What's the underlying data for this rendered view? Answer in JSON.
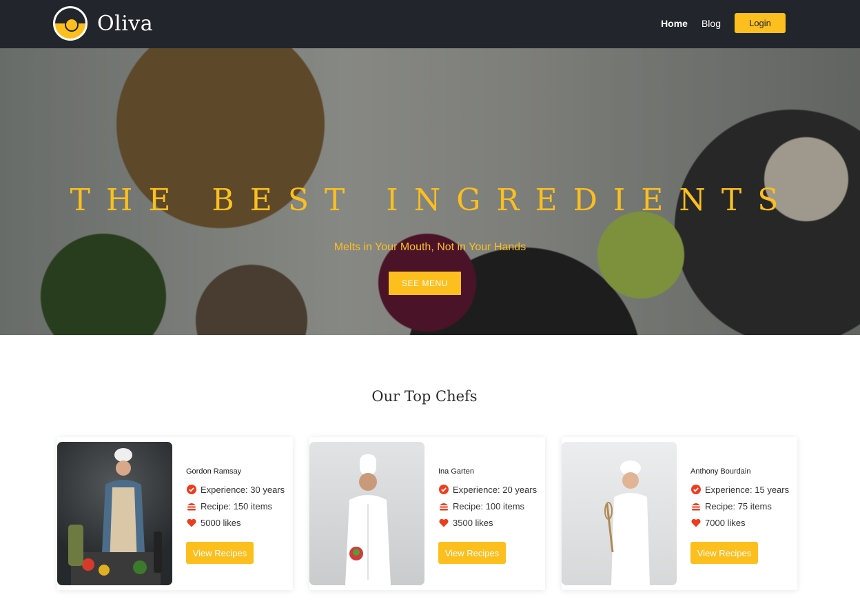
{
  "brand": {
    "name": "Oliva"
  },
  "nav": {
    "links": [
      "Home",
      "Blog"
    ],
    "login_label": "Login"
  },
  "hero": {
    "title": "THE BEST INGREDIENTS",
    "subtitle": "Melts in Your Mouth, Not in Your Hands",
    "button_label": "SEE MENU"
  },
  "chefs": {
    "title": "Our Top Chefs",
    "items": [
      {
        "name": "Gordon Ramsay",
        "experience": "Experience: 30 years",
        "recipes": "Recipe: 150 items",
        "likes": "5000 likes",
        "button": "View Recipes"
      },
      {
        "name": "Ina Garten",
        "experience": "Experience: 20 years",
        "recipes": "Recipe: 100 items",
        "likes": "3500 likes",
        "button": "View Recipes"
      },
      {
        "name": "Anthony Bourdain",
        "experience": "Experience: 15 years",
        "recipes": "Recipe: 75 items",
        "likes": "7000 likes",
        "button": "View Recipes"
      }
    ]
  },
  "colors": {
    "accent": "#fcbf1e",
    "nav_bg": "#22252b",
    "icon_red": "#f03c1e"
  },
  "icons": [
    "check-circle-icon",
    "burger-icon",
    "heart-icon"
  ]
}
